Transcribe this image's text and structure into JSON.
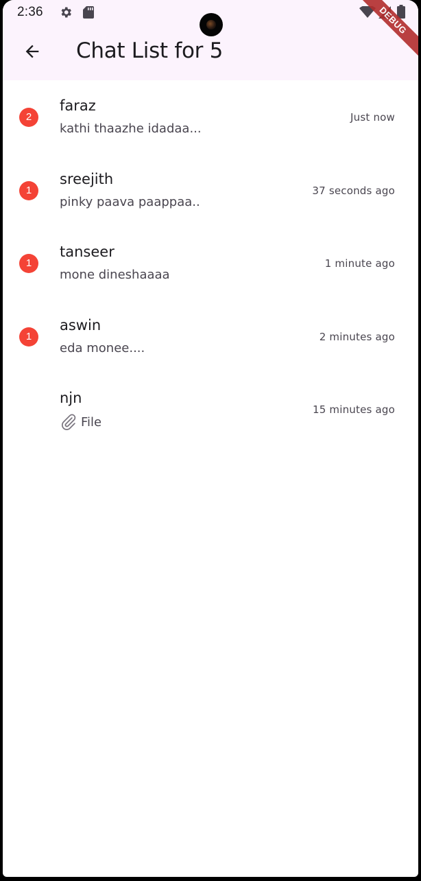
{
  "status_bar": {
    "time": "2:36",
    "icons": [
      "gear-icon",
      "sd-card-icon",
      "wifi-icon",
      "signal-icon",
      "battery-icon"
    ]
  },
  "debug_banner": "DEBUG",
  "app_bar": {
    "title": "Chat List for 5",
    "back_icon": "arrow-left-icon",
    "background": "#fcf3fd"
  },
  "colors": {
    "badge": "#f44336",
    "primary_text": "#1c1b1f",
    "secondary_text": "#49454f"
  },
  "chats": [
    {
      "name": "faraz",
      "preview": "kathi thaazhe idadaa...",
      "time": "Just now",
      "unread": "2"
    },
    {
      "name": "sreejith",
      "preview": "pinky paava paappaa..",
      "time": "37 seconds ago",
      "unread": "1"
    },
    {
      "name": "tanseer",
      "preview": "mone dineshaaaa",
      "time": "1 minute ago",
      "unread": "1"
    },
    {
      "name": "aswin",
      "preview": "eda monee....",
      "time": "2 minutes ago",
      "unread": "1"
    },
    {
      "name": "njn",
      "preview": "File",
      "time": "15 minutes ago",
      "unread": "",
      "attachment_icon": "paperclip-icon"
    }
  ]
}
